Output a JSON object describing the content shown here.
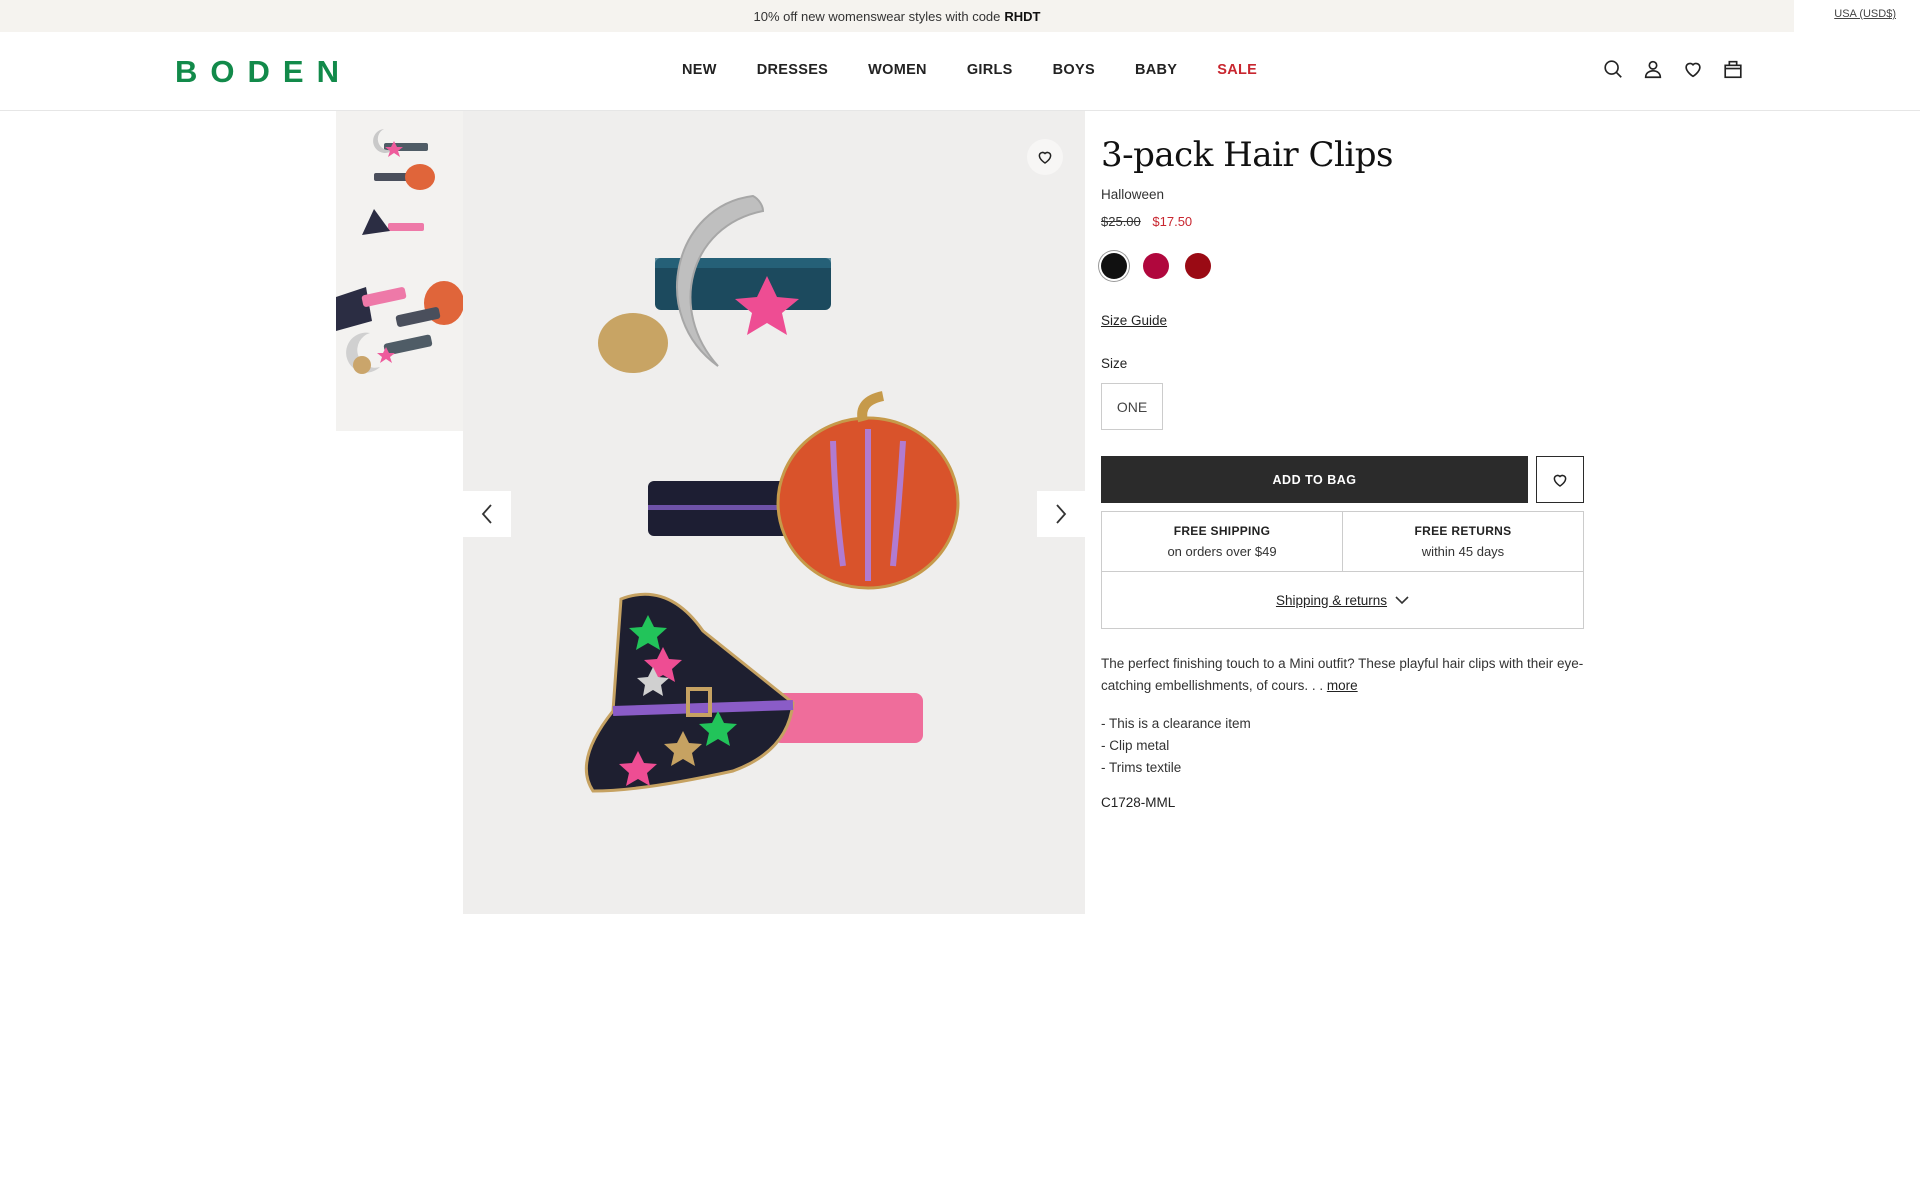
{
  "promo": {
    "text": "10% off new womenswear styles with code",
    "code": "RHDT"
  },
  "locale": "USA (USD$)",
  "logo": "BODEN",
  "nav": [
    {
      "label": "NEW"
    },
    {
      "label": "DRESSES"
    },
    {
      "label": "WOMEN"
    },
    {
      "label": "GIRLS"
    },
    {
      "label": "BOYS"
    },
    {
      "label": "BABY"
    },
    {
      "label": "SALE"
    }
  ],
  "header_icons": [
    "search-icon",
    "account-icon",
    "wishlist-icon",
    "bag-icon"
  ],
  "product": {
    "title": "3-pack Hair Clips",
    "collection": "Halloween",
    "price_was": "$25.00",
    "price_now": "$17.50",
    "swatches": [
      {
        "color": "#111111",
        "selected": true
      },
      {
        "color": "#b0073d",
        "selected": false
      },
      {
        "color": "#9a0a14",
        "selected": false
      }
    ],
    "size_guide": "Size Guide",
    "size_label": "Size",
    "size_option": "ONE",
    "add_to_bag": "ADD TO BAG",
    "free_shipping_title": "FREE SHIPPING",
    "free_shipping_sub": "on orders over $49",
    "free_returns_title": "FREE RETURNS",
    "free_returns_sub": "within 45 days",
    "shipping_link": "Shipping & returns",
    "description": "The perfect finishing touch to a Mini outfit? These playful hair clips with their eye-catching embellishments, of cours. . .",
    "more": "more",
    "bullets": [
      "- This is a clearance item",
      "- Clip metal",
      "- Trims textile"
    ],
    "code": "C1728-MML"
  },
  "colors": {
    "brand": "#128a4a",
    "sale": "#c8262f",
    "button": "#2b2b2b"
  }
}
